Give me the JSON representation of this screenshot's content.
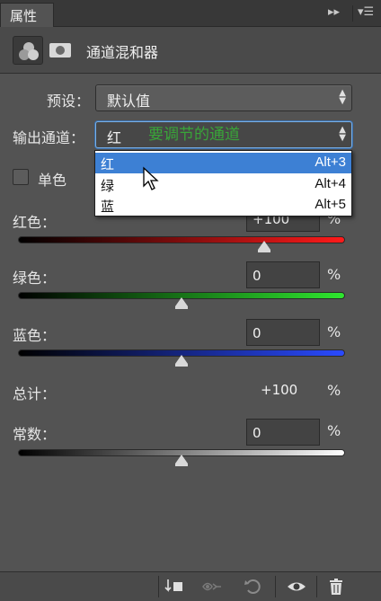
{
  "panel": {
    "tab_title": "属性",
    "title": "通道混和器"
  },
  "preset": {
    "label": "预设：",
    "value": "默认值"
  },
  "output_channel": {
    "label": "输出通道：",
    "value": "红"
  },
  "annotation": "要调节的通道",
  "monochrome": {
    "label": "单色",
    "checked": false
  },
  "channel_menu": {
    "items": [
      {
        "label": "红",
        "shortcut": "Alt+3",
        "selected": true
      },
      {
        "label": "绿",
        "shortcut": "Alt+4",
        "selected": false
      },
      {
        "label": "蓝",
        "shortcut": "Alt+5",
        "selected": false
      }
    ]
  },
  "sliders": {
    "red": {
      "label": "红色：",
      "value": "+100",
      "unit": "%",
      "level": 0.75
    },
    "green": {
      "label": "绿色：",
      "value": "0",
      "unit": "%",
      "level": 0.5
    },
    "blue": {
      "label": "蓝色：",
      "value": "0",
      "unit": "%",
      "level": 0.5
    }
  },
  "total": {
    "label": "总计：",
    "value": "+100",
    "unit": "%"
  },
  "constant": {
    "label": "常数：",
    "value": "0",
    "unit": "%",
    "level": 0.5
  },
  "colors": {
    "panel_bg": "#535353",
    "menu_highlight": "#3d80d4",
    "annotation": "#39a539"
  },
  "icons": {
    "header": [
      "channel-mixer-icon",
      "mask-icon"
    ],
    "bottom": [
      "clip-to-layer-icon",
      "view-previous-icon",
      "reset-icon",
      "visibility-icon",
      "delete-icon"
    ]
  }
}
